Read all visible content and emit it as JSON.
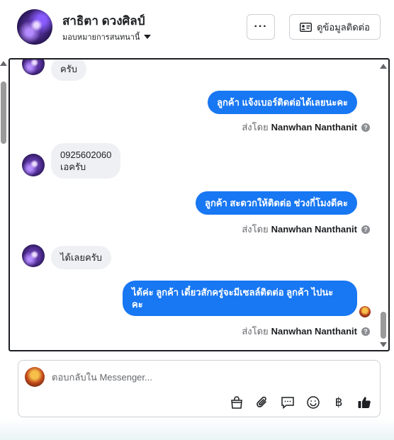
{
  "header": {
    "contact_name": "สาธิตา ดวงศิลป์",
    "assign_label": "มอบหมายการสนทนานี้",
    "more_label": "···",
    "contact_info_label": "ดูข้อมูลติดต่อ"
  },
  "messages": [
    {
      "direction": "in",
      "text": "ครับ"
    },
    {
      "direction": "out",
      "text": "ลูกค้า  แจ้งเบอร์ติดต่อได้เลยนะคะ",
      "sent_by_prefix": "ส่งโดย",
      "sent_by_name": "Nanwhan Nanthanit"
    },
    {
      "direction": "in",
      "text_line1": "0925602060",
      "text_line2": "เอครับ"
    },
    {
      "direction": "out",
      "text": "ลูกค้า สะดวกให้ติดต่อ ช่วงกี่โมงดีคะ",
      "sent_by_prefix": "ส่งโดย",
      "sent_by_name": "Nanwhan Nanthanit"
    },
    {
      "direction": "in",
      "text": "ได้เลยครับ"
    },
    {
      "direction": "out",
      "text_line1": "ได้ค่ะ  ลูกค้า เดี๋ยวสักครู่จะมีเซลล์ติดต่อ ลูกค้า  ไปนะ",
      "text_line2": "คะ",
      "sent_by_prefix": "ส่งโดย",
      "sent_by_name": "Nanwhan Nanthanit"
    }
  ],
  "composer": {
    "placeholder": "ตอบกลับใน Messenger..."
  },
  "icons": {
    "help": "?",
    "baht": "฿"
  },
  "colors": {
    "outgoing_bubble": "#1877f2",
    "incoming_bubble": "#eef0f3",
    "like": "#1c1e21"
  }
}
